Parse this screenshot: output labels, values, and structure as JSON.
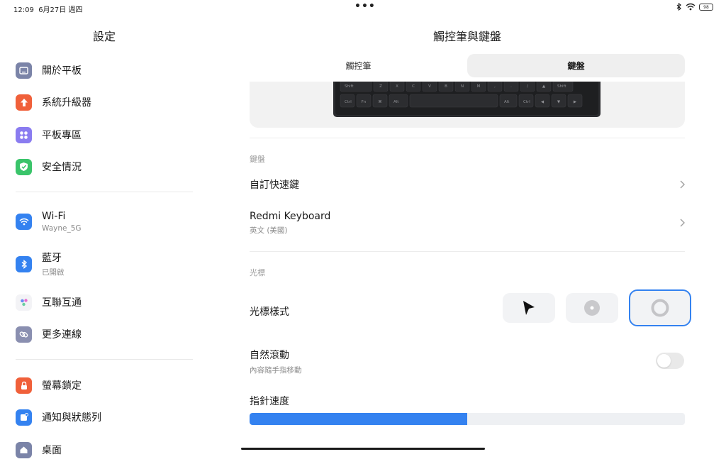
{
  "status": {
    "time": "12:09",
    "date": "6月27日 週四",
    "battery": "98"
  },
  "sidebar": {
    "title": "設定",
    "items": [
      {
        "label": "關於平板",
        "icon": "tablet-icon",
        "color": "#7b84a8"
      },
      {
        "label": "系統升級器",
        "icon": "upgrade-arrow-icon",
        "color": "#f0603a"
      },
      {
        "label": "平板專區",
        "icon": "apps-grid-icon",
        "color": "#8a7cf0"
      },
      {
        "label": "安全情況",
        "icon": "shield-check-icon",
        "color": "#3ac46a"
      },
      {
        "label": "Wi-Fi",
        "sub": "Wayne_5G",
        "icon": "wifi-icon",
        "color": "#3482f0"
      },
      {
        "label": "藍牙",
        "sub": "已開啟",
        "icon": "bluetooth-icon",
        "color": "#3482f0"
      },
      {
        "label": "互聯互通",
        "icon": "interconnect-icon",
        "color": "#f3f3f6"
      },
      {
        "label": "更多連線",
        "icon": "link-icon",
        "color": "#8a8fb0"
      },
      {
        "label": "螢幕鎖定",
        "icon": "lock-icon",
        "color": "#f0603a"
      },
      {
        "label": "通知與狀態列",
        "icon": "notification-icon",
        "color": "#3482f0"
      },
      {
        "label": "桌面",
        "icon": "home-icon",
        "color": "#7b84a8"
      }
    ]
  },
  "main": {
    "title": "觸控筆與鍵盤",
    "tabs": [
      {
        "label": "觸控筆",
        "active": false
      },
      {
        "label": "鍵盤",
        "active": true
      }
    ],
    "keyboard_keys": {
      "row1": [
        "Shift",
        "Z",
        "X",
        "C",
        "V",
        "B",
        "N",
        "M",
        ",",
        ".",
        "/",
        "▲",
        "Shift"
      ],
      "row2": [
        "Ctrl",
        "Fn",
        "⌘",
        "Alt",
        "",
        "Alt",
        "Ctrl",
        "◀",
        "▼",
        "▶"
      ]
    },
    "keyboard_section": {
      "label": "鍵盤",
      "custom_shortcuts": "自訂快速鍵",
      "keyboard_name": "Redmi Keyboard",
      "keyboard_layout": "英文 (美國)"
    },
    "cursor_section": {
      "label": "光標",
      "cursor_style": "光標樣式",
      "options": [
        "arrow-cursor-icon",
        "dot-cursor-icon",
        "ring-cursor-icon"
      ],
      "selected_option": 2,
      "natural_scroll": "自然滾動",
      "natural_scroll_sub": "內容隨手指移動",
      "natural_scroll_on": false,
      "pointer_speed": "指針速度",
      "pointer_speed_level": 0.5
    },
    "accent_color": "#3482f0"
  }
}
